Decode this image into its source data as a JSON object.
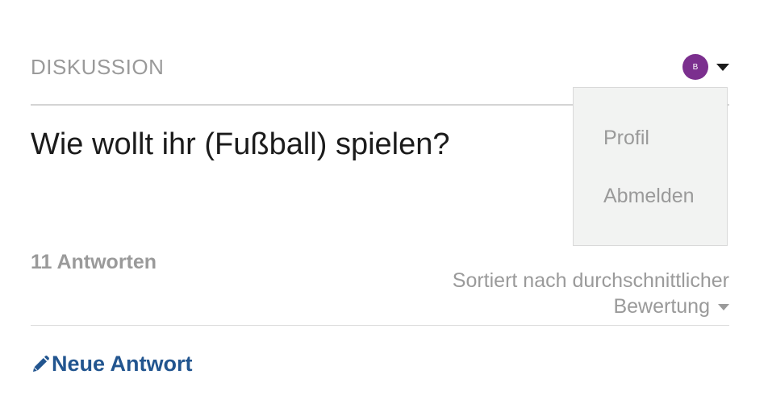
{
  "header": {
    "section_label": "DISKUSSION",
    "avatar_initial": "B",
    "avatar_color": "#7b2f8e"
  },
  "discussion": {
    "title": "Wie wollt ihr (Fußball) spielen?",
    "answer_count": "11 Antworten"
  },
  "sort": {
    "label_line1": "Sortiert nach durchschnittlicher",
    "label_line2": "Bewertung"
  },
  "user_dropdown": {
    "items": [
      {
        "label": "Profil"
      },
      {
        "label": "Abmelden"
      }
    ]
  },
  "actions": {
    "new_answer_label": "Neue Antwort"
  },
  "colors": {
    "link": "#22558f",
    "muted_text": "#9a9a9a",
    "dropdown_bg": "#f2f3f2"
  }
}
